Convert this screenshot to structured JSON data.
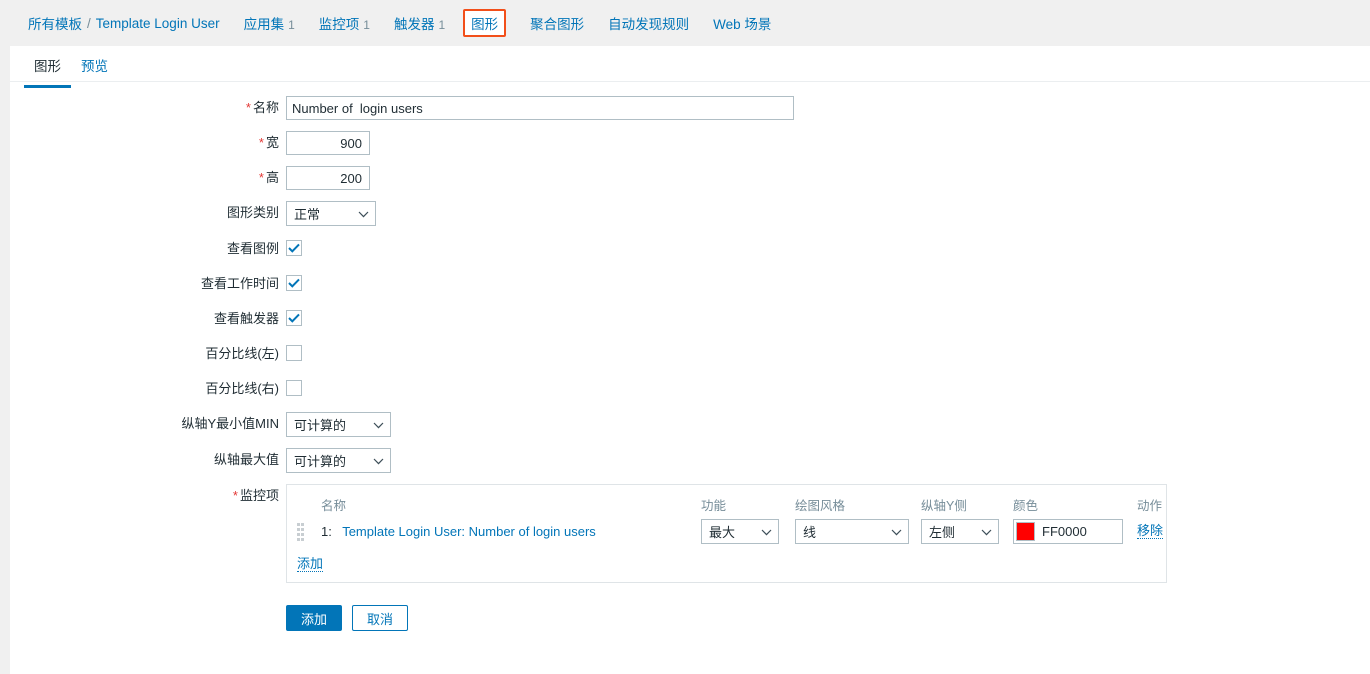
{
  "breadcrumb": {
    "root_label": "所有模板",
    "separator": "/",
    "template_label": "Template Login User"
  },
  "nav": {
    "items": [
      {
        "label": "应用集",
        "count": "1",
        "selected": false
      },
      {
        "label": "监控项",
        "count": "1",
        "selected": false
      },
      {
        "label": "触发器",
        "count": "1",
        "selected": false
      },
      {
        "label": "图形",
        "count": "",
        "selected": true
      },
      {
        "label": "聚合图形",
        "count": "",
        "selected": false
      },
      {
        "label": "自动发现规则",
        "count": "",
        "selected": false
      },
      {
        "label": "Web 场景",
        "count": "",
        "selected": false
      }
    ]
  },
  "tabs": [
    {
      "label": "图形",
      "active": true
    },
    {
      "label": "预览",
      "active": false
    }
  ],
  "form": {
    "name": {
      "label": "名称",
      "required": true,
      "value": "Number of  login users",
      "placeholder": ""
    },
    "width": {
      "label": "宽",
      "required": true,
      "value": "900"
    },
    "height": {
      "label": "高",
      "required": true,
      "value": "200"
    },
    "graph_type": {
      "label": "图形类别",
      "value": "正常"
    },
    "show_legend": {
      "label": "查看图例",
      "checked": true
    },
    "show_working_time": {
      "label": "查看工作时间",
      "checked": true
    },
    "show_triggers": {
      "label": "查看触发器",
      "checked": true
    },
    "percentile_left": {
      "label": "百分比线(左)",
      "checked": false
    },
    "percentile_right": {
      "label": "百分比线(右)",
      "checked": false
    },
    "y_min": {
      "label": "纵轴Y最小值MIN",
      "value": "可计算的"
    },
    "y_max": {
      "label": "纵轴最大值",
      "value": "可计算的"
    }
  },
  "items_section": {
    "label": "监控项",
    "required": true,
    "columns": {
      "name": "名称",
      "function": "功能",
      "draw_style": "绘图风格",
      "y_side": "纵轴Y侧",
      "colour": "颜色",
      "action": "动作"
    },
    "rows": [
      {
        "index": "1:",
        "name": "Template Login User: Number of login users",
        "function": "最大",
        "draw_style": "线",
        "y_side": "左侧",
        "colour_hex": "FF0000",
        "colour_swatch": "#FF0000",
        "action": "移除"
      }
    ],
    "add_label": "添加"
  },
  "footer": {
    "submit_label": "添加",
    "cancel_label": "取消"
  },
  "theme": {
    "accent_blue": "#0275b8",
    "highlight_orange": "#f24f1a",
    "required_red": "#e33734",
    "muted_gray": "#768d99"
  }
}
